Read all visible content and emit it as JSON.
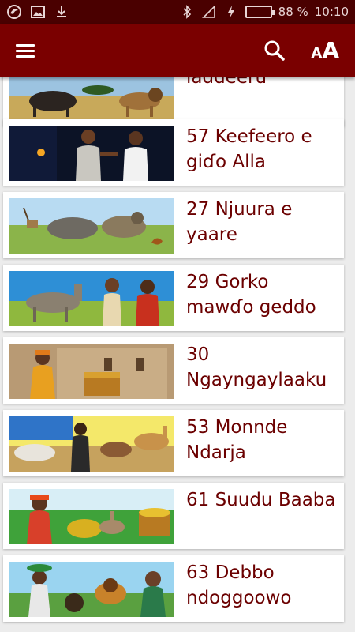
{
  "status_bar": {
    "battery_text": "88 %",
    "time": "10:10",
    "battery_level": 0.88,
    "battery_color": "#4caf50"
  },
  "app_bar": {
    "background": "#7a0000",
    "menu_icon": "hamburger-menu-icon",
    "search_icon": "search-icon",
    "font_size_icon": "font-size-icon",
    "font_size_small": "A",
    "font_size_big": "A"
  },
  "stories": [
    {
      "title": "laddeeru",
      "thumb": "buffalo-lion-savanna"
    },
    {
      "title": "57 Keefeero e giɗo Alla",
      "thumb": "two-men-arguing"
    },
    {
      "title": "27 Njuura e yaare",
      "thumb": "hyenas-antelope-scorpion"
    },
    {
      "title": "29 Gorko mawɗo geddo",
      "thumb": "donkey-men"
    },
    {
      "title": "30 Ngayngaylaaku",
      "thumb": "woman-treasure-chest"
    },
    {
      "title": "53 Monnde Ndarja",
      "thumb": "herder-cattle-camel"
    },
    {
      "title": "61 Suudu Baaba",
      "thumb": "woman-rabbit-treasure"
    },
    {
      "title": "63 Debbo ndoggoowo",
      "thumb": "woman-lion-elder"
    }
  ]
}
